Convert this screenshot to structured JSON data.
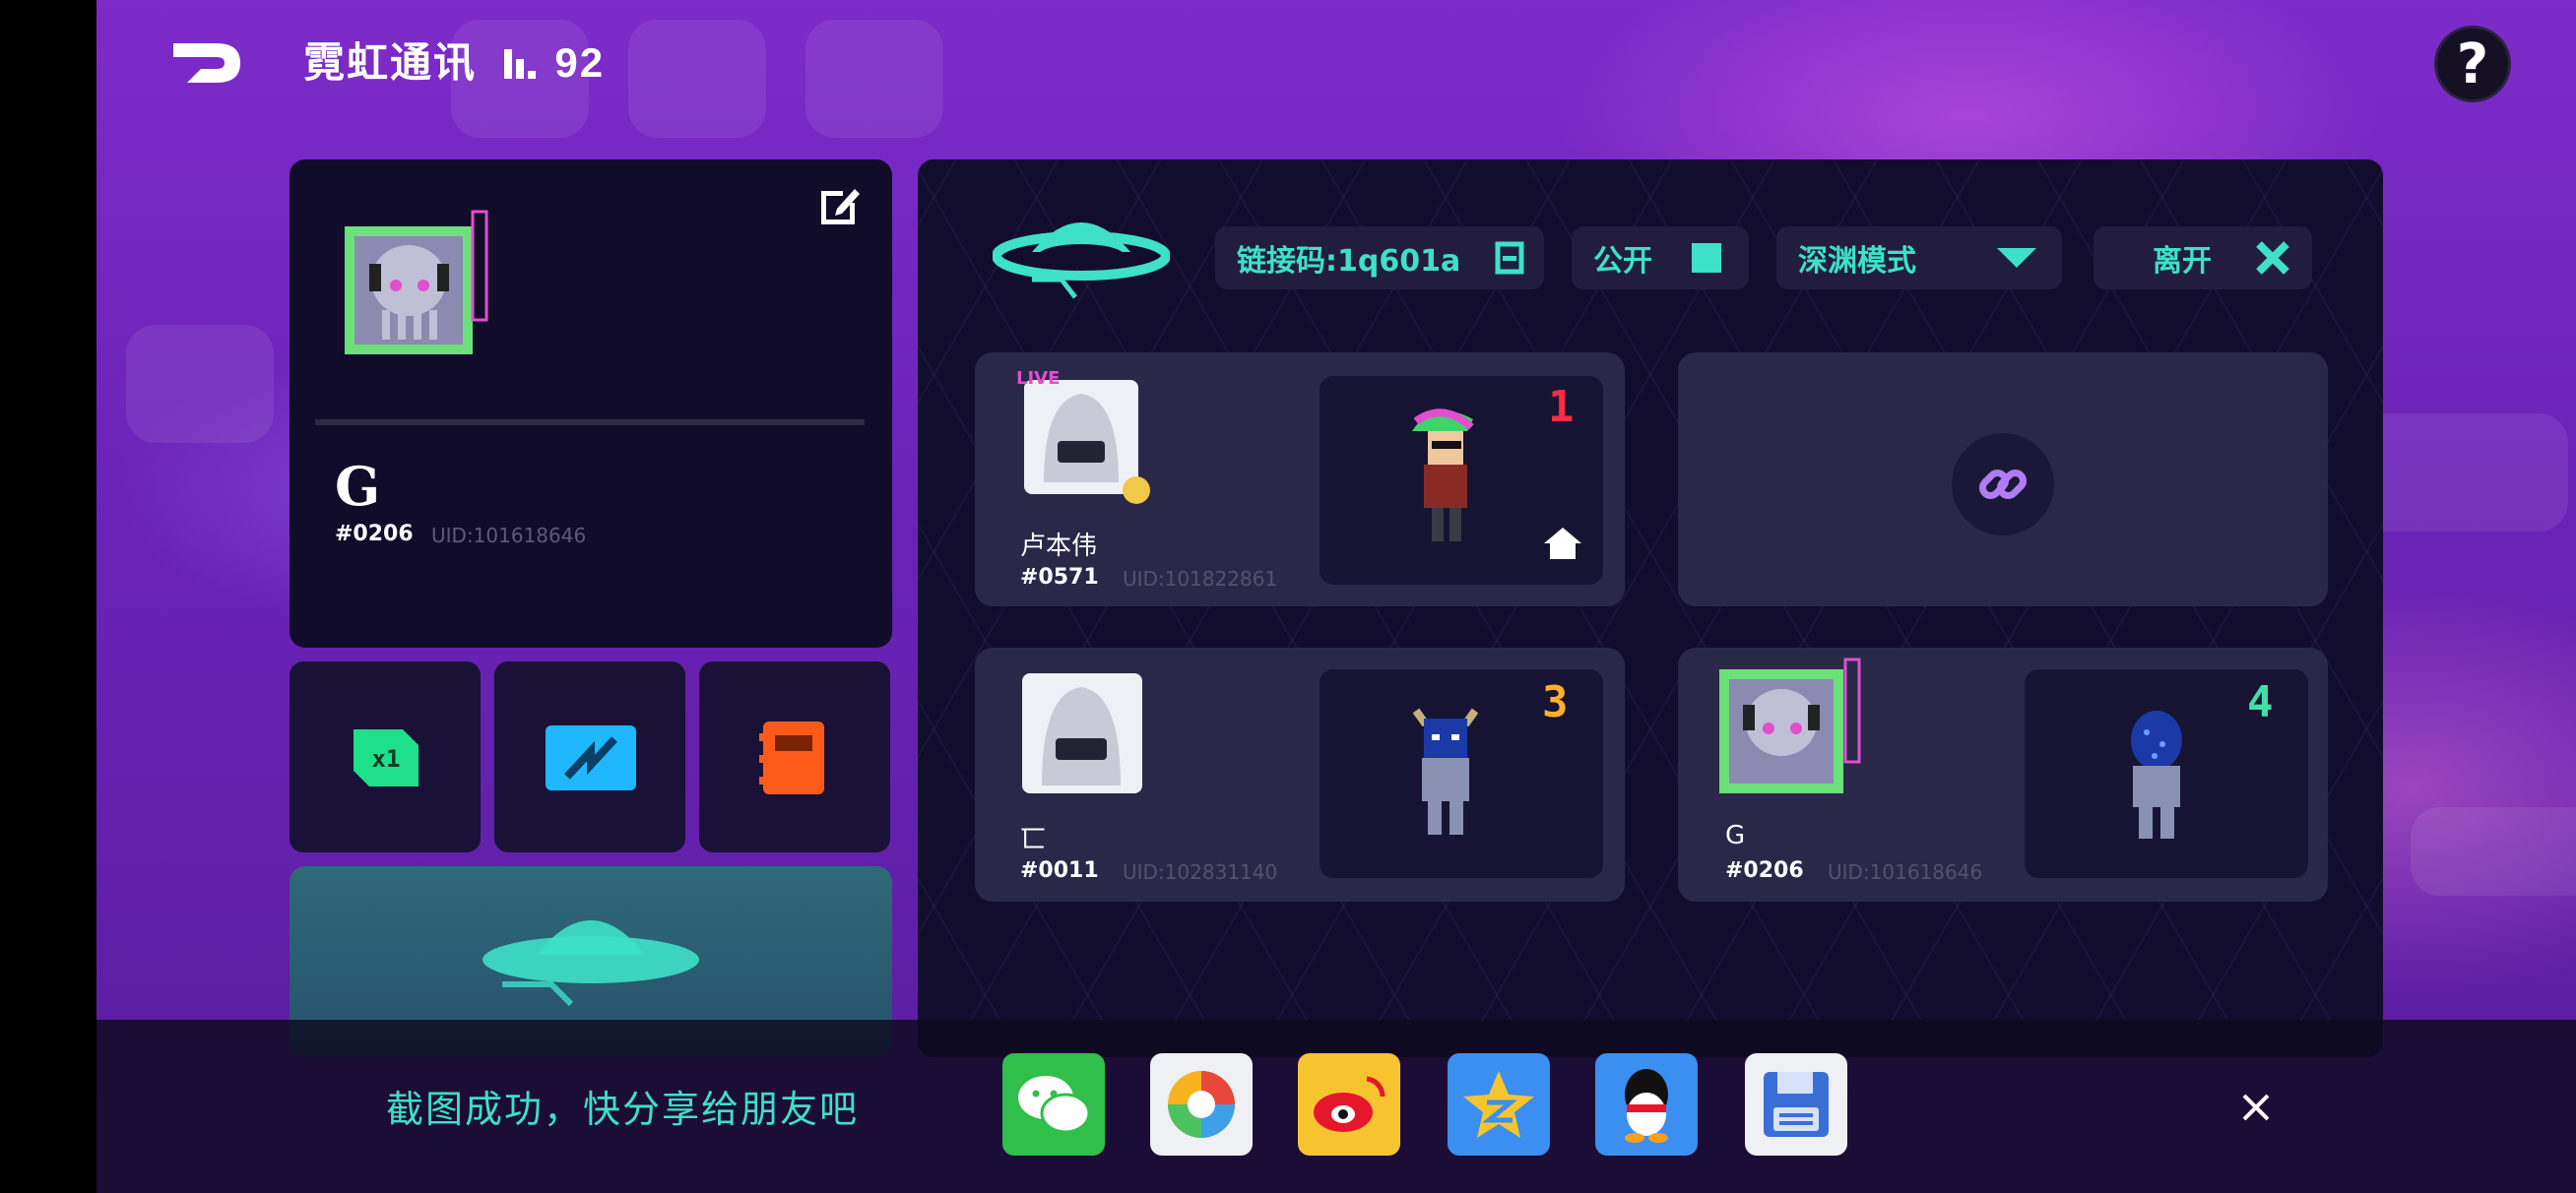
{
  "topbar": {
    "title": "霓虹通讯",
    "signal": "92"
  },
  "profile": {
    "name": "G",
    "tag": "#0206",
    "uid": "UID:101618646"
  },
  "room": {
    "link_code": "链接码:1q601a",
    "public_label": "公开",
    "mode_label": "深渊模式",
    "leave_label": "离开"
  },
  "slots": [
    {
      "name": "卢本伟",
      "tag": "#0571",
      "uid": "UID:101822861",
      "rank": "1",
      "rank_color": "#ff2a44"
    },
    {
      "name": "匸",
      "tag": "#0011",
      "uid": "UID:102831140",
      "rank": "3",
      "rank_color": "#ffb02a"
    },
    {
      "name": "G",
      "tag": "#0206",
      "uid": "UID:101618646",
      "rank": "4",
      "rank_color": "#3ee0a8"
    }
  ],
  "share": {
    "message": "截图成功，快分享给朋友吧"
  },
  "colors": {
    "accent": "#3ee0c8",
    "panel": "#110c2a",
    "bg": "#6a22b6"
  }
}
